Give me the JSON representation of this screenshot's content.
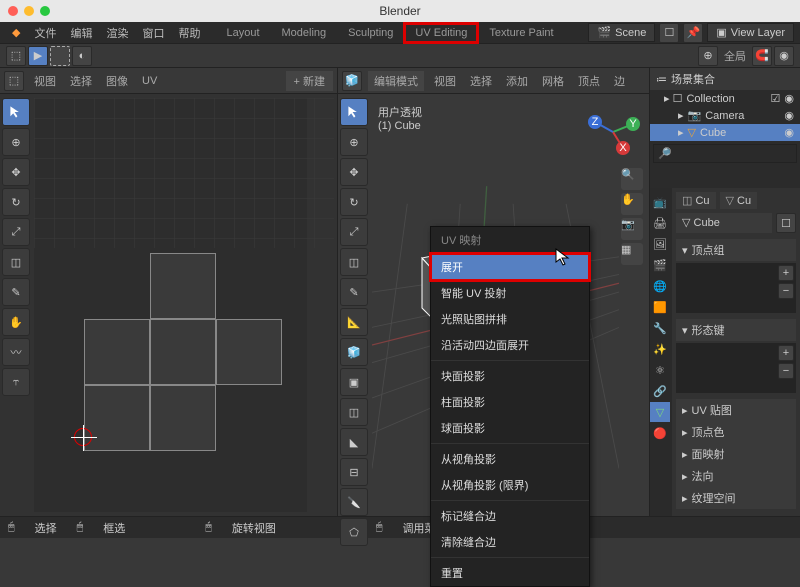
{
  "title": "Blender",
  "traffic": {
    "close": "#ff5f57",
    "min": "#febc2e",
    "max": "#28c840"
  },
  "menubar": [
    "文件",
    "编辑",
    "渲染",
    "窗口",
    "帮助"
  ],
  "workspaces": [
    "Layout",
    "Modeling",
    "Sculpting",
    "UV Editing",
    "Texture Paint"
  ],
  "workspace_hl": "UV Editing",
  "scene_label": "Scene",
  "viewlayer_label": "View Layer",
  "uv_header": {
    "mode": "视图",
    "menu": [
      "视图",
      "选择",
      "图像",
      "UV"
    ]
  },
  "vp_header": {
    "mode": "编辑模式",
    "menu": [
      "视图",
      "选择",
      "添加",
      "网格",
      "顶点",
      "边"
    ]
  },
  "gizmo_global": "全局",
  "vp_info": {
    "line1": "用户透视",
    "line2": "(1) Cube"
  },
  "ctx": {
    "title": "UV 映射",
    "items": [
      "展开",
      "智能 UV 投射",
      "光照贴图拼排",
      "沿活动四边面展开",
      "块面投影",
      "柱面投影",
      "球面投影",
      "从视角投影",
      "从视角投影 (限界)",
      "标记缝合边",
      "清除缝合边",
      "重置"
    ],
    "highlighted": "展开"
  },
  "outliner": {
    "title": "场景集合",
    "items": [
      {
        "name": "Collection",
        "icon": "collection"
      },
      {
        "name": "Camera",
        "icon": "camera"
      },
      {
        "name": "Cube",
        "icon": "mesh",
        "selected": true
      }
    ]
  },
  "props": {
    "cube_label": "Cube",
    "cu_label": "Cu",
    "sections": [
      "顶点组",
      "形态键",
      "UV 贴图",
      "顶点色",
      "面映射",
      "法向",
      "纹理空间"
    ]
  },
  "status": {
    "left1": "选择",
    "left2": "框选",
    "mid": "旋转视图",
    "right": "调用菜单"
  },
  "icons": {
    "blender": "◆",
    "search": "🔍",
    "collection": "□",
    "camera": "📷",
    "mesh": "▽",
    "shield": "⬡",
    "eye": "◉",
    "chevron": "▸"
  }
}
